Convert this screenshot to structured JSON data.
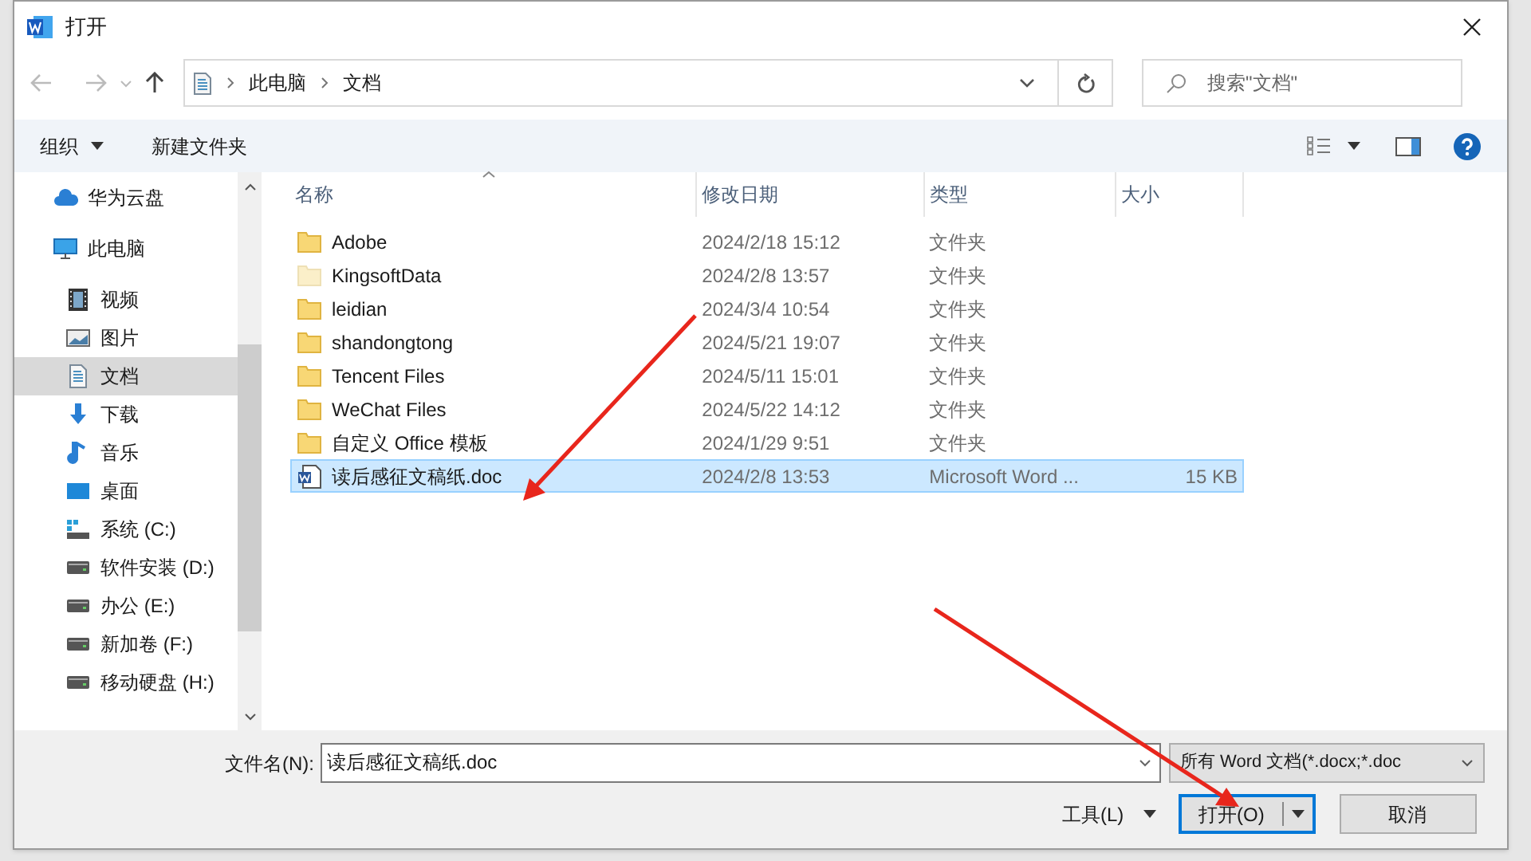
{
  "window": {
    "title": "打开"
  },
  "address": {
    "path": [
      "此电脑",
      "文档"
    ]
  },
  "search": {
    "placeholder": "搜索\"文档\""
  },
  "toolbar": {
    "organize": "组织",
    "new_folder": "新建文件夹"
  },
  "sidebar": {
    "items": [
      {
        "label": "华为云盘",
        "kind": "cloud",
        "selected": false
      },
      {
        "label": "此电脑",
        "kind": "computer",
        "selected": false,
        "children": [
          {
            "label": "视频",
            "kind": "video",
            "selected": false
          },
          {
            "label": "图片",
            "kind": "picture",
            "selected": false
          },
          {
            "label": "文档",
            "kind": "document",
            "selected": true
          },
          {
            "label": "下载",
            "kind": "download",
            "selected": false
          },
          {
            "label": "音乐",
            "kind": "music",
            "selected": false
          },
          {
            "label": "桌面",
            "kind": "desktop",
            "selected": false
          },
          {
            "label": "系统 (C:)",
            "kind": "system-drive",
            "selected": false
          },
          {
            "label": "软件安装 (D:)",
            "kind": "drive",
            "selected": false
          },
          {
            "label": "办公 (E:)",
            "kind": "drive",
            "selected": false
          },
          {
            "label": "新加卷 (F:)",
            "kind": "drive",
            "selected": false
          },
          {
            "label": "移动硬盘 (H:)",
            "kind": "drive",
            "selected": false
          }
        ]
      }
    ]
  },
  "table": {
    "columns": [
      "名称",
      "修改日期",
      "类型",
      "大小"
    ],
    "rows": [
      {
        "kind": "folder",
        "hidden": false,
        "selected": false,
        "cells": [
          "Adobe",
          "2024/2/18 15:12",
          "文件夹",
          ""
        ]
      },
      {
        "kind": "folder",
        "hidden": true,
        "selected": false,
        "cells": [
          "KingsoftData",
          "2024/2/8 13:57",
          "文件夹",
          ""
        ]
      },
      {
        "kind": "folder",
        "hidden": false,
        "selected": false,
        "cells": [
          "leidian",
          "2024/3/4 10:54",
          "文件夹",
          ""
        ]
      },
      {
        "kind": "folder",
        "hidden": false,
        "selected": false,
        "cells": [
          "shandongtong",
          "2024/5/21 19:07",
          "文件夹",
          ""
        ]
      },
      {
        "kind": "folder",
        "hidden": false,
        "selected": false,
        "cells": [
          "Tencent Files",
          "2024/5/11 15:01",
          "文件夹",
          ""
        ]
      },
      {
        "kind": "folder",
        "hidden": false,
        "selected": false,
        "cells": [
          "WeChat Files",
          "2024/5/22 14:12",
          "文件夹",
          ""
        ]
      },
      {
        "kind": "folder",
        "hidden": false,
        "selected": false,
        "cells": [
          "自定义 Office 模板",
          "2024/1/29 9:51",
          "文件夹",
          ""
        ]
      },
      {
        "kind": "word",
        "hidden": false,
        "selected": true,
        "cells": [
          "读后感征文稿纸.doc",
          "2024/2/8 13:53",
          "Microsoft Word ...",
          "15 KB"
        ]
      }
    ]
  },
  "footer": {
    "filename_label": "文件名(N):",
    "filename": "读后感征文稿纸.doc",
    "filetype": "所有 Word 文档(*.docx;*.doc",
    "tools": "工具(L)",
    "open": "打开(O)",
    "cancel": "取消"
  }
}
